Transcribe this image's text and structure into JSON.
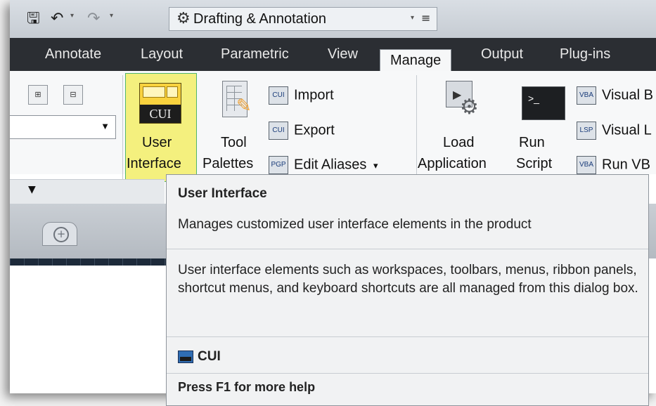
{
  "qat": {
    "workspace_label": "Drafting & Annotation",
    "icons": [
      "save-icon",
      "undo-icon",
      "redo-icon",
      "gear-icon",
      "dropdown-icon",
      "menu-icon"
    ]
  },
  "tabs": [
    {
      "label": "Annotate"
    },
    {
      "label": "Layout"
    },
    {
      "label": "Parametric"
    },
    {
      "label": "View"
    },
    {
      "label": "Manage",
      "active": true
    },
    {
      "label": "Output"
    },
    {
      "label": "Plug-ins"
    }
  ],
  "ribbon": {
    "cui_icon_text": "CUI",
    "user_interface_line1": "User",
    "user_interface_line2": "Interface",
    "tool_palettes_line1": "Tool",
    "tool_palettes_line2": "Palettes",
    "import_label": "Import",
    "export_label": "Export",
    "edit_aliases_label": "Edit Aliases",
    "edit_aliases_caret": "▾",
    "load_line1": "Load",
    "load_line2": "Application",
    "run_line1": "Run",
    "run_line2": "Script",
    "visual_1": "Visual B",
    "visual_2": "Visual L",
    "run_vb": "Run VB",
    "icon_texts": {
      "import": "CUI",
      "export": "CUI",
      "edit_aliases": "PGP",
      "vba": "VBA",
      "lsp": "LSP",
      "vb": "VBA"
    }
  },
  "tooltip": {
    "title": "User Interface",
    "description": "Manages customized user interface elements in the product",
    "extended": "User interface elements such as workspaces, toolbars, menus, ribbon panels, shortcut menus, and keyboard shortcuts are all managed from this dialog box.",
    "command": "CUI",
    "help": "Press F1 for more help"
  },
  "colors": {
    "highlight": "#f4f07e",
    "tab_bar": "#2b2e33",
    "tooltip_bg": "#f1f2f3"
  }
}
